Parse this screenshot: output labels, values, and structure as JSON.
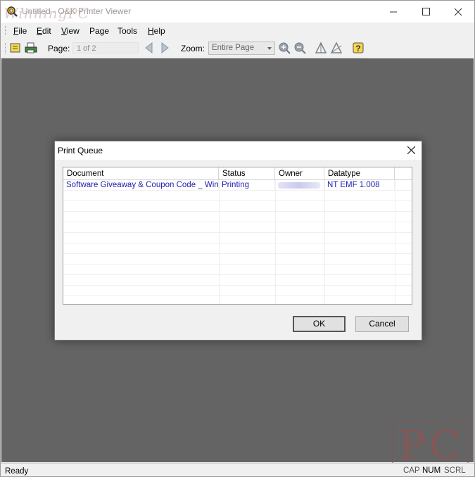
{
  "window": {
    "title": "Untitled - O&K Printer Viewer",
    "watermark_text": "WinningPC"
  },
  "menu": {
    "items": [
      {
        "underlined": "F",
        "rest": "ile"
      },
      {
        "underlined": "E",
        "rest": "dit"
      },
      {
        "underlined": "V",
        "rest": "iew"
      },
      {
        "underlined": "",
        "rest": "Page"
      },
      {
        "underlined": "",
        "rest": "Tools"
      },
      {
        "underlined": "H",
        "rest": "elp"
      }
    ]
  },
  "toolbar": {
    "page_label": "Page:",
    "page_value": "1 of 2",
    "zoom_label": "Zoom:",
    "zoom_value": "Entire Page",
    "icons": [
      "open-icon",
      "print-icon",
      "prev-page-icon",
      "next-page-icon",
      "zoom-in-icon",
      "zoom-out-icon",
      "rotate-left-icon",
      "rotate-right-icon",
      "help-icon"
    ]
  },
  "dialog": {
    "title": "Print Queue",
    "columns": [
      "Document",
      "Status",
      "Owner",
      "Datatype"
    ],
    "rows": [
      {
        "document": "Software Giveaway & Coupon Code _ Win...",
        "status": "Printing",
        "owner": "",
        "datatype": "NT EMF 1.008"
      }
    ],
    "ok_label": "OK",
    "cancel_label": "Cancel"
  },
  "statusbar": {
    "ready": "Ready",
    "cap": "CAP",
    "num": "NUM",
    "scrl": "SCRL"
  },
  "corner_watermark": "PC",
  "colors": {
    "workspace": "#646464",
    "list_text": "#1f1fb0",
    "chrome": "#f0f0f0"
  }
}
